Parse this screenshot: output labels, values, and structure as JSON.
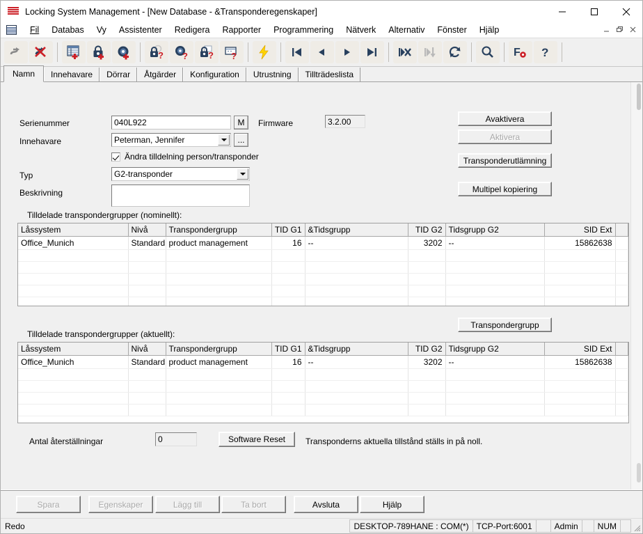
{
  "window": {
    "title": "Locking System Management - [New Database - &Transponderegenskaper]",
    "minimize": "–",
    "maximize": "□",
    "close": "✕"
  },
  "menu": {
    "items": [
      {
        "label": "Fil",
        "accel": "F"
      },
      {
        "label": "Databas",
        "accel": "b"
      },
      {
        "label": "Vy",
        "accel": "y"
      },
      {
        "label": "Assistenter",
        "accel": "t"
      },
      {
        "label": "Redigera",
        "accel": "e"
      },
      {
        "label": "Rapporter",
        "accel": "R"
      },
      {
        "label": "Programmering",
        "accel": "P"
      },
      {
        "label": "Nätverk",
        "accel": "N"
      },
      {
        "label": "Alternativ",
        "accel": "A"
      },
      {
        "label": "Fönster",
        "accel": "ö"
      },
      {
        "label": "Hjälp",
        "accel": "H"
      }
    ],
    "mdi_restore": "🗗",
    "mdi_minimize": "_",
    "mdi_close": "×"
  },
  "toolbar": {
    "buttons": [
      {
        "name": "transfer-icon",
        "title": "Transfer"
      },
      {
        "name": "cancel-transfer-icon",
        "title": "Cancel transfer"
      },
      {
        "name": "add-locking-system-icon",
        "title": "New locking system"
      },
      {
        "name": "add-lock-icon",
        "title": "New lock"
      },
      {
        "name": "add-transponder-icon",
        "title": "New transponder"
      },
      {
        "name": "lock-properties-icon",
        "title": "Lock properties"
      },
      {
        "name": "transponder-properties-icon",
        "title": "Transponder properties"
      },
      {
        "name": "locking-plan-properties-icon",
        "title": "Locking plan properties"
      },
      {
        "name": "card-properties-icon",
        "title": "Card properties"
      },
      {
        "name": "quick-program-icon",
        "title": "Program"
      },
      {
        "name": "first-record-icon",
        "title": "First"
      },
      {
        "name": "previous-record-icon",
        "title": "Previous"
      },
      {
        "name": "next-record-icon",
        "title": "Next"
      },
      {
        "name": "last-record-icon",
        "title": "Last"
      },
      {
        "name": "delete-record-icon",
        "title": "Delete"
      },
      {
        "name": "jump-record-icon",
        "title": "Jump"
      },
      {
        "name": "refresh-icon",
        "title": "Refresh"
      },
      {
        "name": "search-icon",
        "title": "Search"
      },
      {
        "name": "filter-settings-icon",
        "title": "Settings"
      },
      {
        "name": "help-icon",
        "title": "Help"
      }
    ]
  },
  "tabs": [
    {
      "label": "Namn",
      "active": true
    },
    {
      "label": "Innehavare",
      "active": false
    },
    {
      "label": "Dörrar",
      "active": false
    },
    {
      "label": "Åtgärder",
      "active": false
    },
    {
      "label": "Konfiguration",
      "active": false
    },
    {
      "label": "Utrustning",
      "active": false
    },
    {
      "label": "Tillträdeslista",
      "active": false
    }
  ],
  "form": {
    "serial_label": "Serienummer",
    "serial_value": "040L922",
    "serial_m_button": "M",
    "firmware_label": "Firmware",
    "firmware_value": "3.2.00",
    "owner_label": "Innehavare",
    "owner_value": "Peterman, Jennifer",
    "owner_browse_button": "...",
    "change_assignment_label": "Ändra tilldelning person/transponder",
    "change_assignment_checked": true,
    "type_label": "Typ",
    "type_value": "G2-transponder",
    "description_label": "Beskrivning",
    "description_value": ""
  },
  "side_buttons": {
    "deactivate": "Avaktivera",
    "activate": "Aktivera",
    "activate_disabled": true,
    "transponder_handout": "Transponderutlämning",
    "multiple_copy": "Multipel kopiering",
    "transponder_group": "Transpondergrupp"
  },
  "groups_nominal": {
    "caption": "Tilldelade transpondergrupper (nominellt):",
    "columns": [
      "Låssystem",
      "Nivå",
      "Transpondergrupp",
      "TID G1",
      "&Tidsgrupp",
      "TID G2",
      "Tidsgrupp G2",
      "SID Ext",
      ""
    ],
    "rows": [
      [
        "Office_Munich",
        "Standard",
        "product management",
        "16",
        "--",
        "3202",
        "--",
        "15862638",
        ""
      ]
    ],
    "empty_rows": 6
  },
  "groups_actual": {
    "caption": "Tilldelade transpondergrupper (aktuellt):",
    "columns": [
      "Låssystem",
      "Nivå",
      "Transpondergrupp",
      "TID G1",
      "&Tidsgrupp",
      "TID G2",
      "Tidsgrupp G2",
      "SID Ext",
      ""
    ],
    "rows": [
      [
        "Office_Munich",
        "Standard",
        "product management",
        "16",
        "--",
        "3202",
        "--",
        "15862638",
        ""
      ]
    ],
    "empty_rows": 5
  },
  "reset_row": {
    "label": "Antal återställningar",
    "value": "0",
    "button": "Software Reset",
    "hint": "Transponderns aktuella tillstånd ställs in på noll."
  },
  "bottom_buttons": [
    {
      "label": "Spara",
      "accel": "S",
      "disabled": true,
      "name": "save-button"
    },
    {
      "label": "Egenskaper",
      "accel": "E",
      "disabled": true,
      "name": "properties-button"
    },
    {
      "label": "Lägg till",
      "accel": "L",
      "disabled": true,
      "name": "add-button"
    },
    {
      "label": "Ta bort",
      "accel": "T",
      "disabled": true,
      "name": "delete-button"
    },
    {
      "label": "Avsluta",
      "accel": "",
      "disabled": false,
      "name": "exit-button"
    },
    {
      "label": "Hjälp",
      "accel": "H",
      "disabled": false,
      "name": "help-button"
    }
  ],
  "statusbar": {
    "message": "Redo",
    "connection": "DESKTOP-789HANE : COM(*)",
    "port": "TCP-Port:6001",
    "blank1": "",
    "user": "Admin",
    "blank2": "",
    "num": "NUM",
    "blank3": ""
  },
  "colors": {
    "accent_red": "#cc2027",
    "toolbar_bg": "#f0f0f0",
    "icon_navy": "#28405e",
    "icon_yellow": "#ffd400"
  }
}
